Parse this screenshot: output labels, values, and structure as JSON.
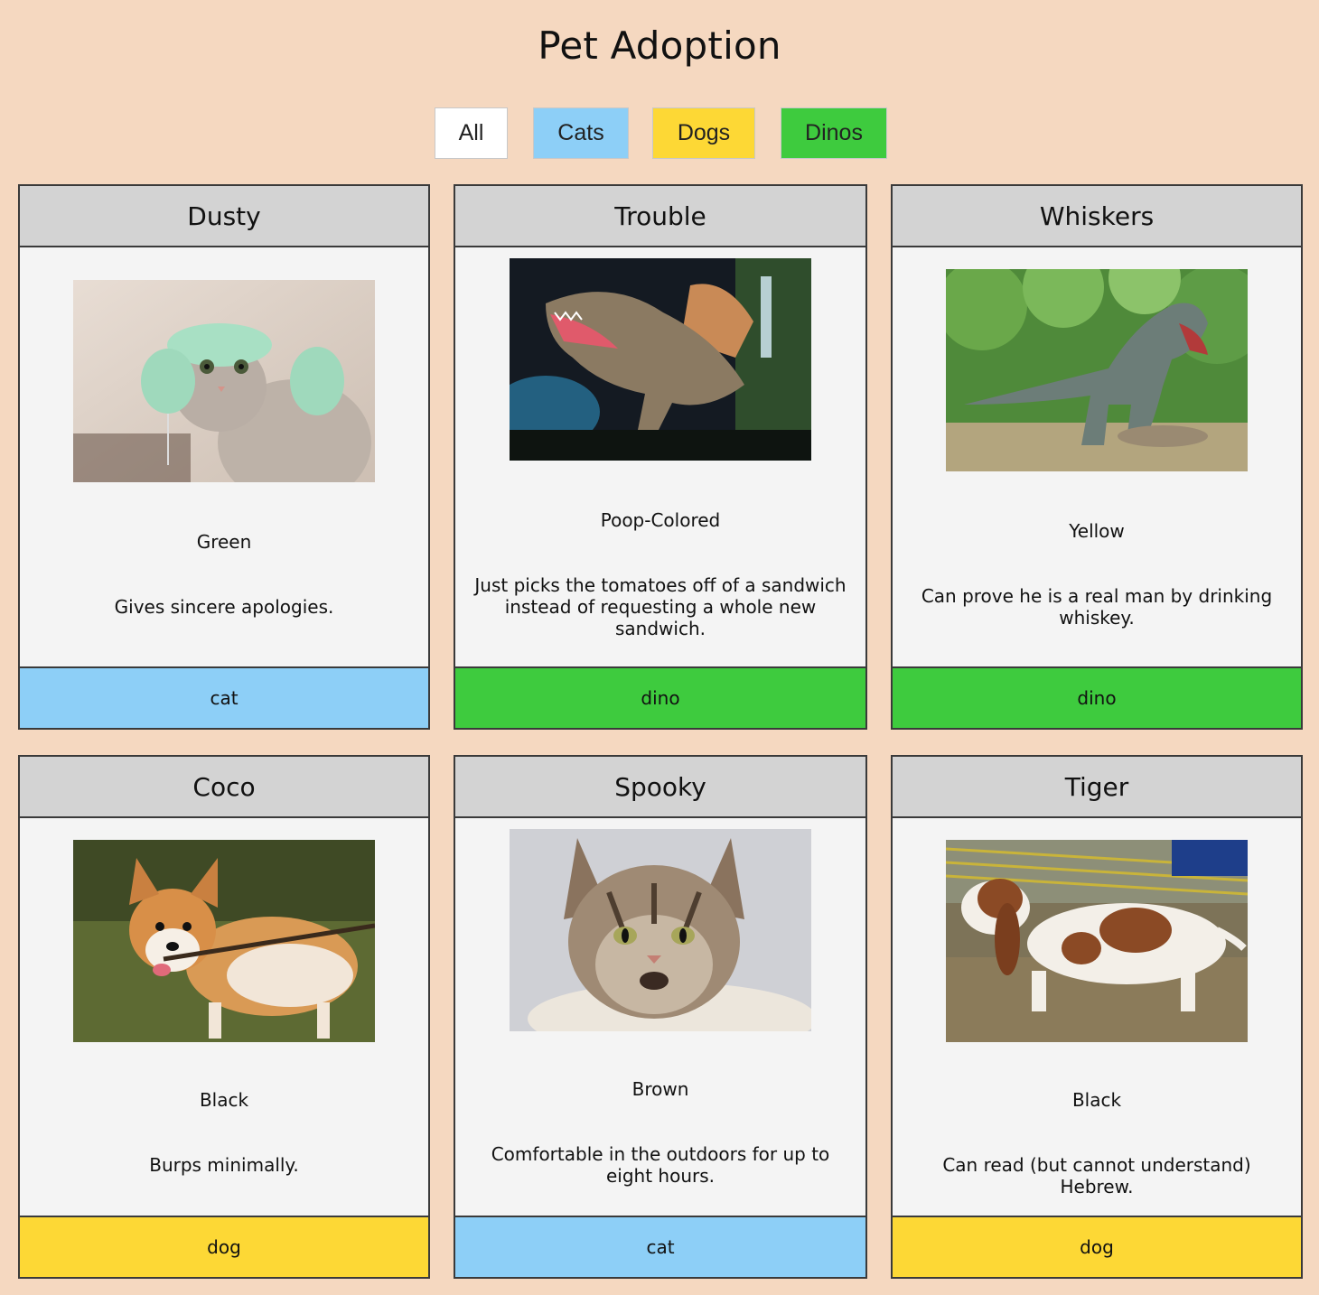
{
  "page": {
    "title": "Pet Adoption"
  },
  "filters": [
    {
      "label": "All",
      "color": "#ffffff"
    },
    {
      "label": "Cats",
      "color": "#8dcff7"
    },
    {
      "label": "Dogs",
      "color": "#fdd835"
    },
    {
      "label": "Dinos",
      "color": "#3ecb3e"
    }
  ],
  "pets": [
    {
      "name": "Dusty",
      "photo": "cat-photo",
      "color": "Green",
      "description": "Gives sincere apologies.",
      "type": "cat"
    },
    {
      "name": "Trouble",
      "photo": "dinosaur-photo",
      "color": "Poop-Colored",
      "description": "Just picks the tomatoes off of a sandwich instead of requesting a whole new sandwich.",
      "type": "dino"
    },
    {
      "name": "Whiskers",
      "photo": "dinosaur-photo",
      "color": "Yellow",
      "description": "Can prove he is a real man by drinking whiskey.",
      "type": "dino"
    },
    {
      "name": "Coco",
      "photo": "dog-photo",
      "color": "Black",
      "description": "Burps minimally.",
      "type": "dog"
    },
    {
      "name": "Spooky",
      "photo": "cat-photo",
      "color": "Brown",
      "description": "Comfortable in the outdoors for up to eight hours.",
      "type": "cat"
    },
    {
      "name": "Tiger",
      "photo": "dog-photo",
      "color": "Black",
      "description": "Can read (but cannot understand) Hebrew.",
      "type": "dog"
    }
  ]
}
